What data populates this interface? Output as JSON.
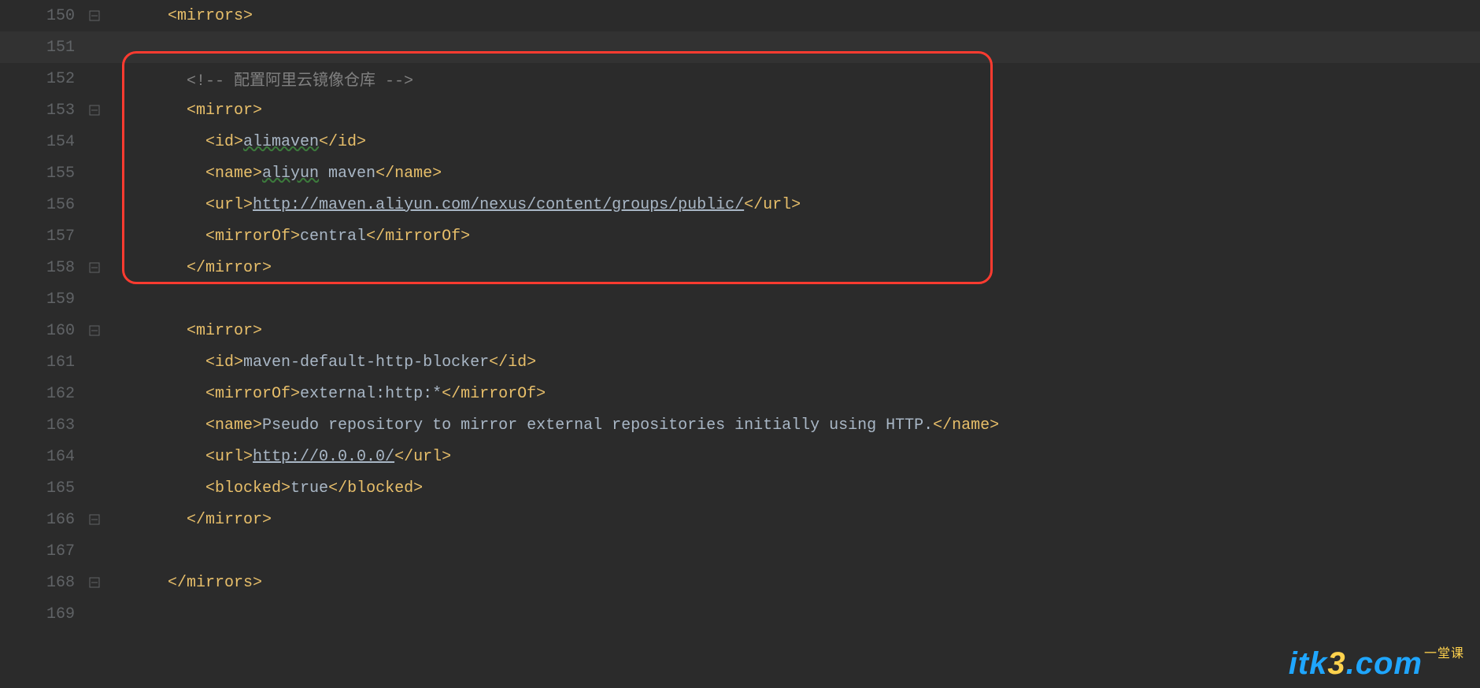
{
  "lines": [
    {
      "num": "150",
      "fold": "open",
      "indent": "    ",
      "tokens": [
        [
          "tag",
          "<mirrors>"
        ]
      ]
    },
    {
      "num": "151",
      "fold": "line",
      "indent": "",
      "tokens": [],
      "current": true
    },
    {
      "num": "152",
      "fold": "line",
      "indent": "      ",
      "tokens": [
        [
          "comment",
          "<!-- 配置阿里云镜像仓库 -->"
        ]
      ]
    },
    {
      "num": "153",
      "fold": "open",
      "indent": "      ",
      "tokens": [
        [
          "tag",
          "<mirror>"
        ]
      ]
    },
    {
      "num": "154",
      "fold": "line",
      "indent": "        ",
      "tokens": [
        [
          "tag",
          "<id>"
        ],
        [
          "wavy",
          "alimaven"
        ],
        [
          "tag",
          "</id>"
        ]
      ]
    },
    {
      "num": "155",
      "fold": "line",
      "indent": "        ",
      "tokens": [
        [
          "tag",
          "<name>"
        ],
        [
          "wavy",
          "aliyun"
        ],
        [
          "txt",
          " maven"
        ],
        [
          "tag",
          "</name>"
        ]
      ]
    },
    {
      "num": "156",
      "fold": "line",
      "indent": "        ",
      "tokens": [
        [
          "tag",
          "<url>"
        ],
        [
          "link",
          "http://maven.aliyun.com/nexus/content/groups/public/"
        ],
        [
          "tag",
          "</url>"
        ]
      ]
    },
    {
      "num": "157",
      "fold": "line",
      "indent": "        ",
      "tokens": [
        [
          "tag",
          "<mirrorOf>"
        ],
        [
          "txt",
          "central"
        ],
        [
          "tag",
          "</mirrorOf>"
        ]
      ]
    },
    {
      "num": "158",
      "fold": "close",
      "indent": "      ",
      "tokens": [
        [
          "tag",
          "</mirror>"
        ]
      ]
    },
    {
      "num": "159",
      "fold": "line",
      "indent": "",
      "tokens": []
    },
    {
      "num": "160",
      "fold": "open",
      "indent": "      ",
      "tokens": [
        [
          "tag",
          "<mirror>"
        ]
      ]
    },
    {
      "num": "161",
      "fold": "line",
      "indent": "        ",
      "tokens": [
        [
          "tag",
          "<id>"
        ],
        [
          "txt",
          "maven-default-http-blocker"
        ],
        [
          "tag",
          "</id>"
        ]
      ]
    },
    {
      "num": "162",
      "fold": "line",
      "indent": "        ",
      "tokens": [
        [
          "tag",
          "<mirrorOf>"
        ],
        [
          "txt",
          "external:http:*"
        ],
        [
          "tag",
          "</mirrorOf>"
        ]
      ]
    },
    {
      "num": "163",
      "fold": "line",
      "indent": "        ",
      "tokens": [
        [
          "tag",
          "<name>"
        ],
        [
          "txt",
          "Pseudo repository to mirror external repositories initially using HTTP."
        ],
        [
          "tag",
          "</name>"
        ]
      ]
    },
    {
      "num": "164",
      "fold": "line",
      "indent": "        ",
      "tokens": [
        [
          "tag",
          "<url>"
        ],
        [
          "link",
          "http://0.0.0.0/"
        ],
        [
          "tag",
          "</url>"
        ]
      ]
    },
    {
      "num": "165",
      "fold": "line",
      "indent": "        ",
      "tokens": [
        [
          "tag",
          "<blocked>"
        ],
        [
          "txt",
          "true"
        ],
        [
          "tag",
          "</blocked>"
        ]
      ]
    },
    {
      "num": "166",
      "fold": "close",
      "indent": "      ",
      "tokens": [
        [
          "tag",
          "</mirror>"
        ]
      ]
    },
    {
      "num": "167",
      "fold": "line",
      "indent": "",
      "tokens": []
    },
    {
      "num": "168",
      "fold": "close",
      "indent": "    ",
      "tokens": [
        [
          "tag",
          "</mirrors>"
        ]
      ]
    },
    {
      "num": "169",
      "fold": "line",
      "indent": "",
      "tokens": []
    }
  ],
  "watermark": {
    "prefix": "itk",
    "three": "3",
    "suffix": ".com",
    "sub": "一堂课"
  }
}
